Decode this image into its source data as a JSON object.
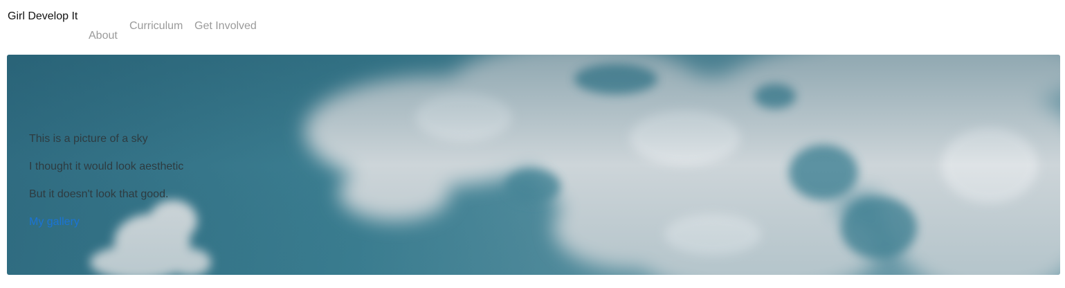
{
  "navbar": {
    "brand": "Girl Develop It",
    "links": [
      {
        "label": "About"
      },
      {
        "label": "Curriculum"
      },
      {
        "label": "Get Involved"
      }
    ]
  },
  "hero": {
    "background_image": "sky-with-clouds",
    "lines": [
      "This is a picture of a sky",
      "I thought it would look aesthetic",
      "But it doesn't look that good."
    ],
    "link_label": "My gallery"
  },
  "colors": {
    "nav_link": "#9a9a9a",
    "brand_text": "#111111",
    "hero_text": "#2e3b40",
    "link": "#1a74d6",
    "sky_blue": "#3c7f92",
    "cloud": "#cfd6da"
  }
}
